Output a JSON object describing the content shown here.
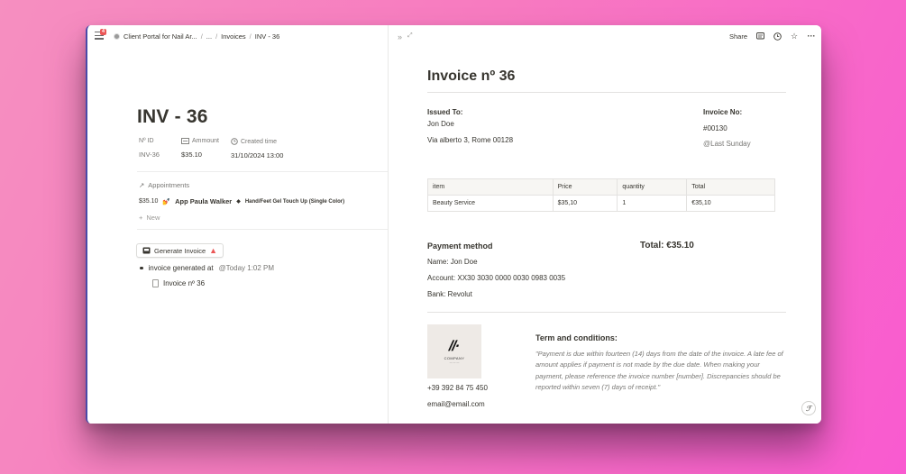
{
  "topbar": {
    "notification_count": "4",
    "breadcrumb": [
      "Client Portal for Nail Ar...",
      "...",
      "Invoices",
      "INV - 36"
    ],
    "separator": "/"
  },
  "left_page": {
    "title": "INV - 36",
    "properties": [
      {
        "label": "Nº ID",
        "value": "INV-36"
      },
      {
        "label": "Ammount",
        "value": "$35.10"
      },
      {
        "label": "Created time",
        "value": "31/10/2024 13:00"
      }
    ],
    "appointments_label": "Appointments",
    "appointment": {
      "price": "$35.10",
      "name": "App Paula Walker",
      "service": "Hand/Feet Gel Touch Up (Single Color)"
    },
    "new_label": "New",
    "generate_button": "Generate Invoice",
    "log_text": "invoice generated at",
    "log_time": "@Today 1:02 PM",
    "subpage": "Invoice nº 36"
  },
  "right_topbar": {
    "share_label": "Share"
  },
  "invoice": {
    "title": "Invoice nº  36",
    "issued_to_label": "Issued To:",
    "issued_name": "Jon Doe",
    "issued_address": "Via alberto 3, Rome 00128",
    "invoice_no_label": "Invoice No:",
    "invoice_no": "#00130",
    "invoice_date": "@Last Sunday",
    "table": {
      "headers": [
        "item",
        "Price",
        "quantity",
        "Total"
      ],
      "rows": [
        [
          "Beauty Service",
          "$35,10",
          "1",
          "€35,10"
        ]
      ]
    },
    "payment_method_label": "Payment method",
    "total_label": "Total:  €35.10",
    "payment_name": "Name: Jon Doe",
    "payment_account": "Account: XX30 3030 0000 0030 0983 0035",
    "payment_bank": "Bank: Revolut",
    "logo_text": "COMPANY",
    "phone": "+39 392 84 75 450",
    "email": "email@email.com",
    "terms_label": "Term and conditions:",
    "terms_text": "\"Payment is due within fourteen (14) days from the date of the invoice. A late fee of amount applies if payment is not made by the due date. When making your payment, please reference the invoice number [number]. Discrepancies should be reported within seven (7) days of receipt.\""
  },
  "colors": {
    "accent_warning": "#eb5757",
    "text": "#37352f",
    "muted": "#787774",
    "background_gradient": "#f77ac0"
  }
}
